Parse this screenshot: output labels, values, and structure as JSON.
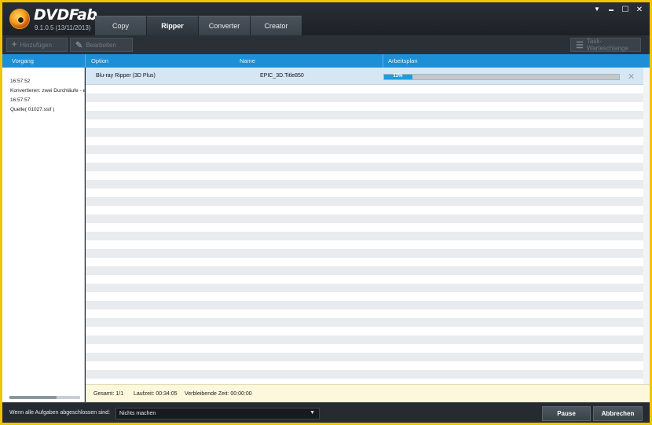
{
  "app": {
    "brand": "DVDFab",
    "version": "9.1.0.5 (13/11/2013)"
  },
  "tabs": [
    {
      "label": "Copy"
    },
    {
      "label": "Ripper"
    },
    {
      "label": "Converter"
    },
    {
      "label": "Creator"
    }
  ],
  "window_buttons": {
    "menu": "▼",
    "minimize": "▬",
    "maximize": "☐",
    "close": "✕"
  },
  "toolbar": {
    "add_label": "Hinzufügen",
    "edit_label": "Bearbeiten",
    "queue_label": "Task-Warteschlange"
  },
  "columns": {
    "vorgang": "Vorgang",
    "option": "Option",
    "name": "Name",
    "arbeitsplan": "Arbeitsplan"
  },
  "log": [
    "16:57:52",
    "Konvertieren: zwei Durchläufe - e",
    "16:57:57",
    "Quelle( 01027.ssif )"
  ],
  "task": {
    "option": "Blu-ray Ripper (3D Plus)",
    "name": "EPIC_3D.Title850",
    "progress_text": "12%",
    "progress": 0.12
  },
  "summary": {
    "total": "Gesamt: 1/1",
    "runtime": "Laufzeit: 00:34:05",
    "remaining": "Verbleibende Zeit: 00:00:00"
  },
  "bottom": {
    "done_label": "Wenn alle Aufgaben abgeschlossen sind:",
    "done_value": "Nichts machen",
    "pause_label": "Pause",
    "cancel_label": "Abbrechen"
  },
  "colors": {
    "accent": "#1d8fd6",
    "progress": "#1f9be0",
    "window_border": "#f2c400"
  }
}
